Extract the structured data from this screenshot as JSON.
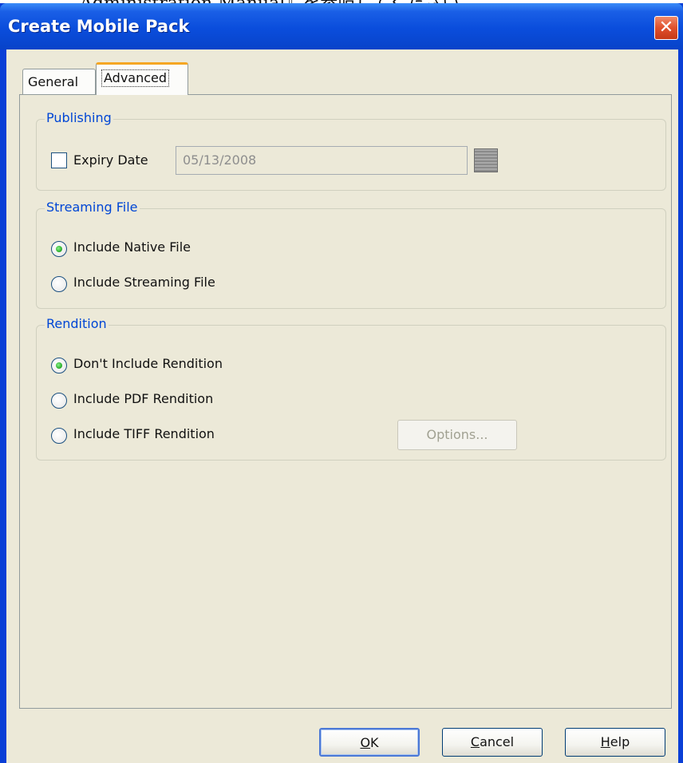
{
  "background": {
    "document_text": "Administration Manual』を参照してください。"
  },
  "window": {
    "title": "Create Mobile Pack",
    "close_glyph": "✕"
  },
  "tabs": [
    {
      "label": "General",
      "active": false
    },
    {
      "label": "Advanced",
      "active": true
    }
  ],
  "publishing": {
    "group_label": "Publishing",
    "expiry_checkbox_label": "Expiry Date",
    "expiry_checked": false,
    "expiry_date_value": "05/13/2008",
    "calendar_icon": "calendar-icon"
  },
  "streaming_file": {
    "group_label": "Streaming File",
    "options": [
      {
        "label": "Include Native File",
        "checked": true
      },
      {
        "label": "Include Streaming File",
        "checked": false
      }
    ]
  },
  "rendition": {
    "group_label": "Rendition",
    "options": [
      {
        "label": "Don't Include Rendition",
        "checked": true
      },
      {
        "label": "Include PDF Rendition",
        "checked": false
      },
      {
        "label": "Include TIFF Rendition",
        "checked": false
      }
    ],
    "options_button_label": "Options..."
  },
  "buttons": {
    "ok": {
      "mnemonic": "O",
      "rest": "K"
    },
    "cancel": {
      "mnemonic": "C",
      "rest": "ancel"
    },
    "help": {
      "mnemonic": "H",
      "rest": "elp"
    }
  },
  "colors": {
    "titlebar": "#0a4ddc",
    "group_label": "#0046d5",
    "dialog_bg": "#ece9d8",
    "radio_checked": "#31b231"
  }
}
